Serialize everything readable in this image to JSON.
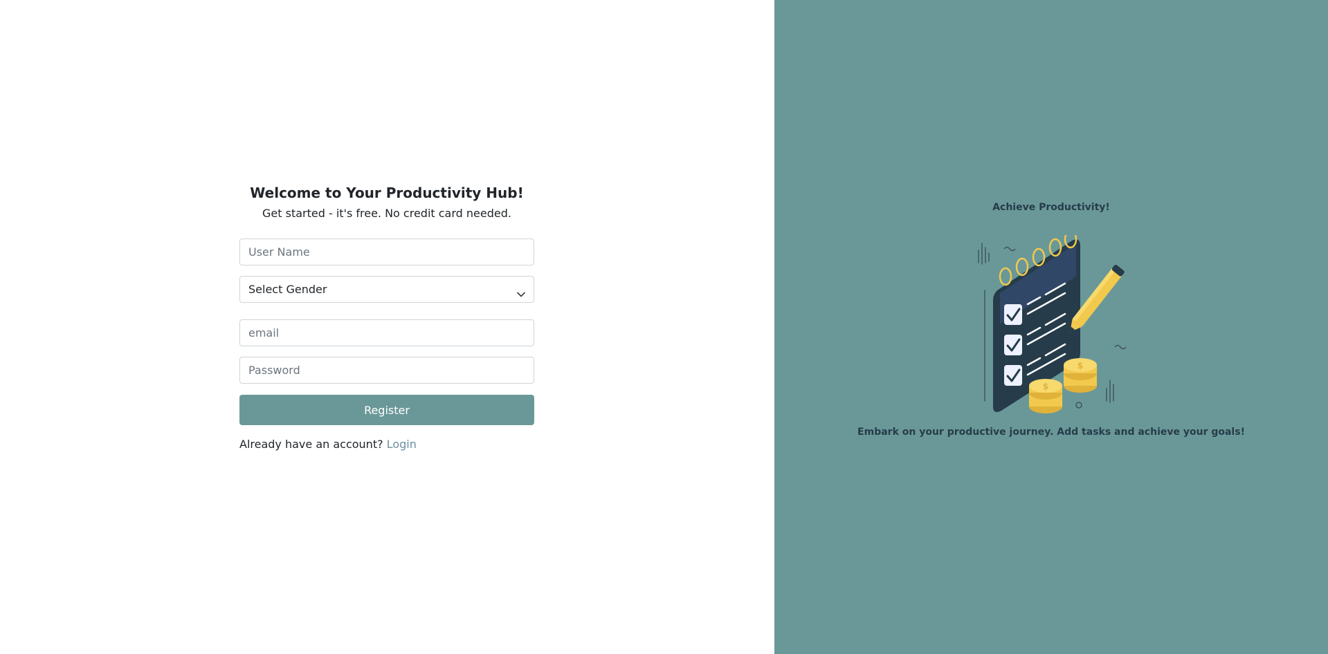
{
  "register": {
    "heading": "Welcome to Your Productivity Hub!",
    "subheading": "Get started - it's free. No credit card needed.",
    "username_placeholder": "User Name",
    "gender_selected": "Select Gender",
    "email_placeholder": "email",
    "password_placeholder": "Password",
    "register_label": "Register",
    "login_prompt": "Already have an account?",
    "login_link": "Login"
  },
  "promo": {
    "title": "Achieve Productivity!",
    "caption": "Embark on your productive journey. Add tasks and achieve your goals!",
    "illustration_icon": "checklist-pencil-coins-illustration"
  },
  "colors": {
    "accent": "#6a9898",
    "link": "#6a8fa0",
    "promo_text": "#263c4a"
  }
}
